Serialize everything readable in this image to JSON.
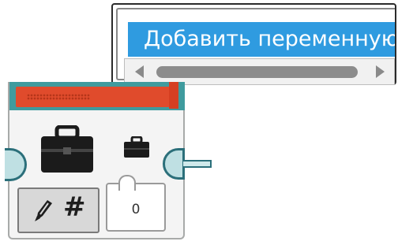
{
  "popup": {
    "name_field": "Добавить переменную"
  },
  "block": {
    "value": "0",
    "mode_label": "#",
    "icons": {
      "large": "briefcase-icon",
      "small": "briefcase-icon",
      "mode": "pencil-icon"
    }
  },
  "colors": {
    "header_red": "#e04b2c",
    "header_teal": "#3f9b9e",
    "name_field_bg": "#2f9be0",
    "port": "#2b6f7a"
  }
}
